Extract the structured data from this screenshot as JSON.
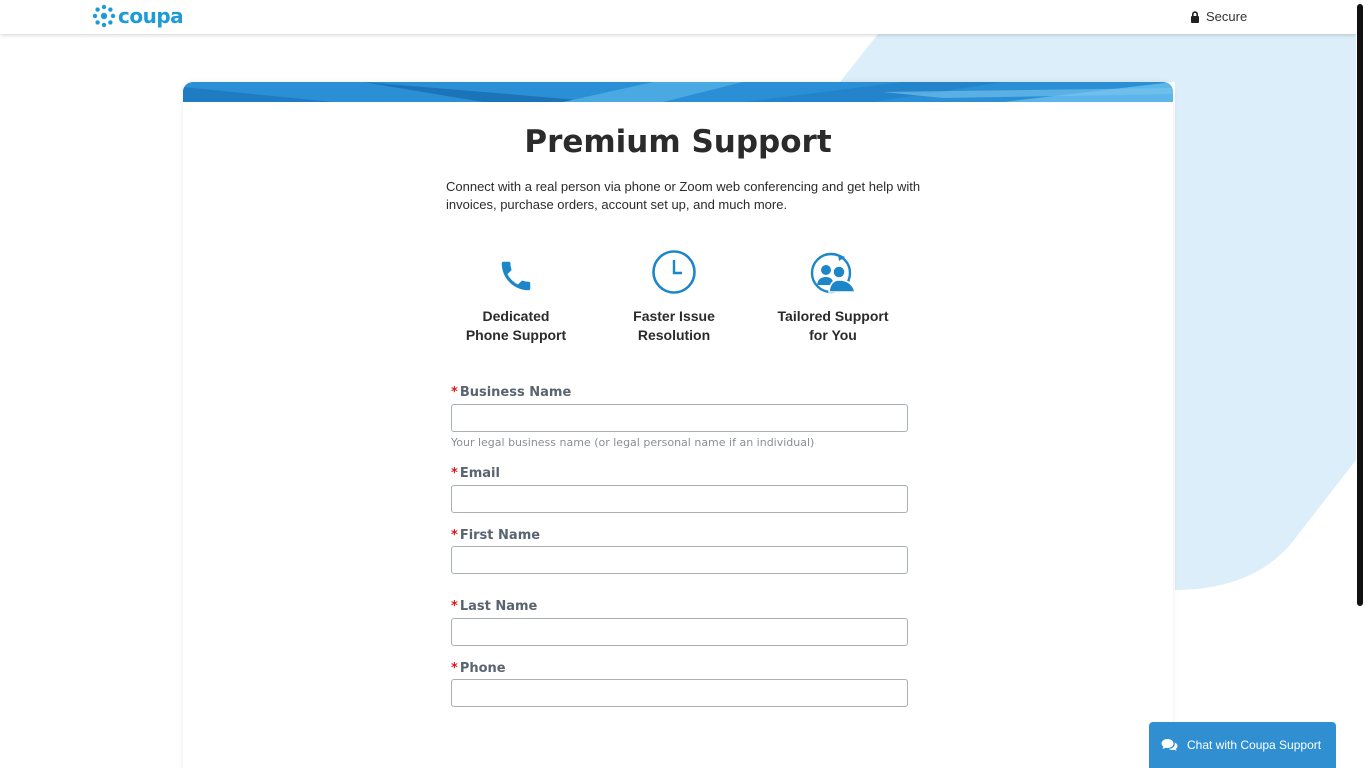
{
  "header": {
    "logo_text": "coupa",
    "secure_label": "Secure"
  },
  "card": {
    "title": "Premium Support",
    "intro": "Connect with a real person via phone or Zoom web conferencing and get help with invoices, purchase orders, account set up, and much more.",
    "features": [
      {
        "icon": "phone-icon",
        "line1": "Dedicated",
        "line2": "Phone Support"
      },
      {
        "icon": "clock-icon",
        "line1": "Faster Issue",
        "line2": "Resolution"
      },
      {
        "icon": "people-icon",
        "line1": "Tailored Support",
        "line2": "for You"
      }
    ]
  },
  "form": {
    "required_marker": "*",
    "business_name": {
      "label": "Business Name",
      "value": "",
      "help": "Your legal business name (or legal personal name if an individual)"
    },
    "email": {
      "label": "Email",
      "value": ""
    },
    "first_name": {
      "label": "First Name",
      "value": ""
    },
    "last_name": {
      "label": "Last Name",
      "value": ""
    },
    "phone": {
      "label": "Phone",
      "value": ""
    }
  },
  "chat": {
    "label": "Chat with Coupa Support",
    "icon": "chat-bubbles-icon"
  },
  "colors": {
    "brand_blue": "#1d9bd7",
    "accent_blue": "#2f8fd1",
    "required_red": "#d81a1a",
    "bg_shape": "#dceef9"
  }
}
